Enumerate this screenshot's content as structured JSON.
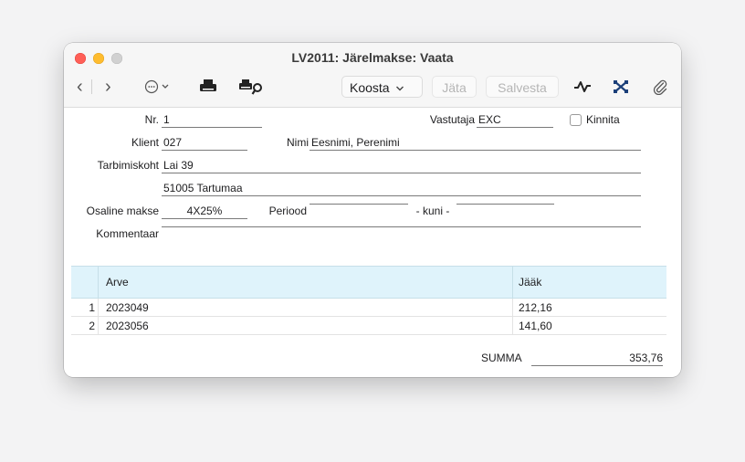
{
  "window": {
    "title": "LV2011: Järelmakse: Vaata"
  },
  "toolbar": {
    "koosta_label": "Koosta",
    "jata_label": "Jäta",
    "salvesta_label": "Salvesta"
  },
  "form": {
    "nr": {
      "label": "Nr.",
      "value": "1"
    },
    "vastutaja": {
      "label": "Vastutaja",
      "value": "EXC"
    },
    "kinnita": {
      "label": "Kinnita",
      "checked": false
    },
    "klient": {
      "label": "Klient",
      "value": "027"
    },
    "nimi": {
      "label": "Nimi",
      "value": "Eesnimi, Perenimi"
    },
    "tarbimiskoht": {
      "label": "Tarbimiskoht",
      "line1": "Lai 39",
      "line2": "51005 Tartumaa"
    },
    "osaline_makse": {
      "label": "Osaline makse",
      "value": "4X25%"
    },
    "periood": {
      "label": "Periood",
      "from": "",
      "kuni_label": "- kuni -",
      "to": ""
    },
    "kommentaar": {
      "label": "Kommentaar",
      "value": ""
    }
  },
  "table": {
    "columns": [
      "Arve",
      "Jääk"
    ],
    "rows": [
      {
        "num": "1",
        "arve": "2023049",
        "jaak": "212,16"
      },
      {
        "num": "2",
        "arve": "2023056",
        "jaak": "141,60"
      }
    ]
  },
  "total": {
    "label": "SUMMA",
    "value": "353,76"
  },
  "icons": {
    "back": "chevron-left-icon",
    "forward": "chevron-right-icon",
    "more": "ellipsis-circle-icon",
    "print": "printer-icon",
    "print_preview": "print-preview-icon",
    "activity": "activity-icon",
    "expand": "expand-icon",
    "attach": "paperclip-icon"
  },
  "colors": {
    "grid_header_bg": "#dff3fb",
    "close": "#ff5f57",
    "minimize": "#febc2e",
    "zoom_disabled": "#d1d1d1"
  }
}
